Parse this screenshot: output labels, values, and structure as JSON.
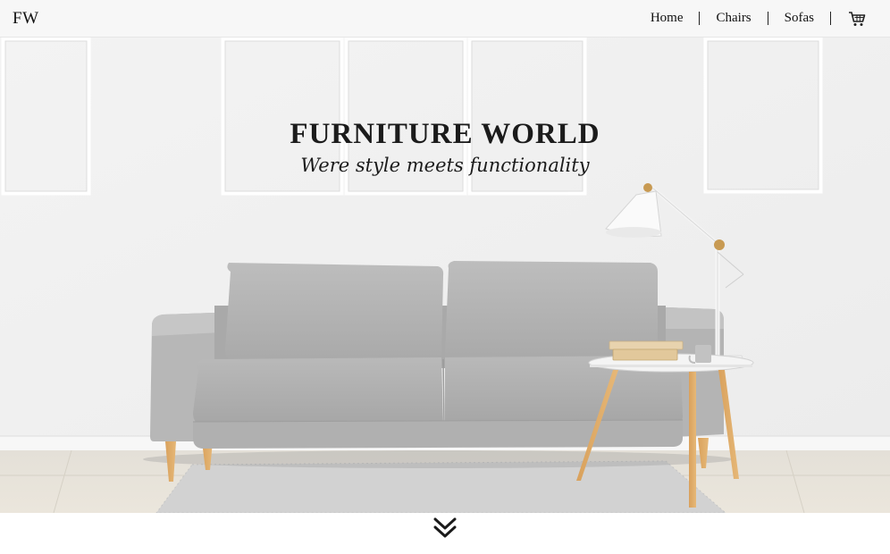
{
  "header": {
    "logo": "FW",
    "nav": [
      {
        "label": "Home"
      },
      {
        "label": "Chairs"
      },
      {
        "label": "Sofas"
      }
    ],
    "cart_icon": "shopping-cart-icon"
  },
  "hero": {
    "title": "FURNITURE WORLD",
    "tagline": "Were style meets functionality",
    "background": "living-room-photo"
  },
  "footer": {
    "scroll_icon": "double-chevron-down-icon"
  }
}
